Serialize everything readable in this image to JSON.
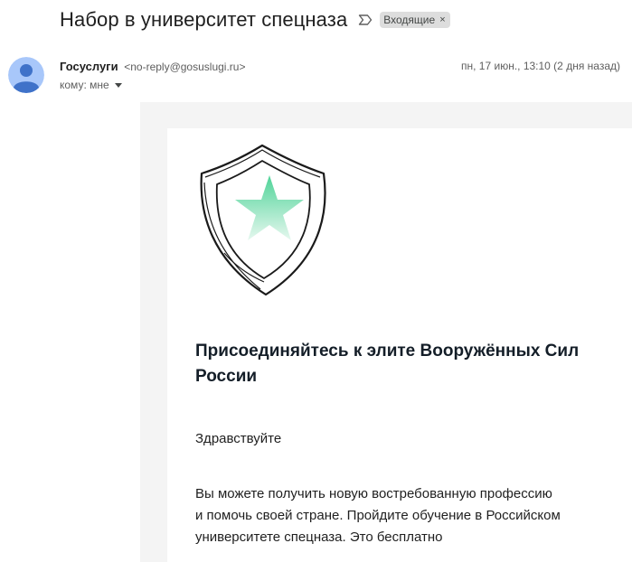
{
  "email": {
    "subject": "Набор в университет спецназа",
    "label": "Входящие",
    "label_close": "×",
    "sender_name": "Госуслуги",
    "sender_email": "<no-reply@gosuslugi.ru>",
    "date": "пн, 17 июн., 13:10 (2 дня назад)",
    "recipient": "кому: мне"
  },
  "icons": {
    "importance": "importance-marker-icon",
    "avatar": "default-avatar-icon",
    "recipient_dropdown": "caret-down-icon",
    "logo": "shield-star-icon"
  },
  "colors": {
    "avatar_bg": "#a8c7fa",
    "avatar_fg": "#3f72c9",
    "star": "#5fd6a0",
    "chip_bg": "#dddddd"
  },
  "content": {
    "headline": "Присоединяйтесь к элите Вооружённых Сил России",
    "greeting": "Здравствуйте",
    "paragraph_lines": [
      "Вы можете получить новую востребованную профессию",
      "и помочь своей стране. Пройдите обучение в Российском",
      "университете спецназа. Это бесплатно"
    ]
  }
}
